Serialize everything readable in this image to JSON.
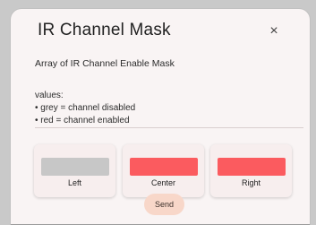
{
  "dialog": {
    "title": "IR Channel Mask",
    "close_glyph": "×",
    "subtitle": "Array of IR Channel Enable Mask",
    "values_heading": "values:",
    "legend": [
      "• grey = channel disabled",
      "• red = channel enabled"
    ]
  },
  "channels": [
    {
      "label": "Left",
      "state": "disabled",
      "color": "#c7c7c7"
    },
    {
      "label": "Center",
      "state": "enabled",
      "color": "#fb5b5f"
    },
    {
      "label": "Right",
      "state": "enabled",
      "color": "#fb5b5f"
    }
  ],
  "actions": {
    "send_label": "Send"
  },
  "colors": {
    "dialog_bg": "#f9f4f4",
    "send_bg": "#f8d7c9"
  }
}
